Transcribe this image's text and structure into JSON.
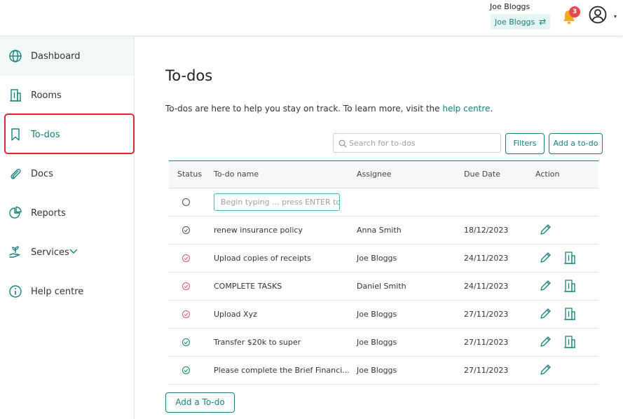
{
  "header": {
    "user_name": "Joe Bloggs",
    "account_label": "Joe Bloggs",
    "switch_symbol": "⇄",
    "notification_count": "3",
    "caret": "▾"
  },
  "sidebar": {
    "items": [
      {
        "label": "Dashboard",
        "icon": "globe-icon"
      },
      {
        "label": "Rooms",
        "icon": "building-icon"
      },
      {
        "label": "To-dos",
        "icon": "bookmark-icon"
      },
      {
        "label": "Docs",
        "icon": "paperclip-icon"
      },
      {
        "label": "Reports",
        "icon": "pie-chart-icon"
      },
      {
        "label": "Services",
        "icon": "plant-hand-icon"
      },
      {
        "label": "Help centre",
        "icon": "info-icon"
      }
    ]
  },
  "main": {
    "title": "To-dos",
    "intro_text": "To-dos are here to help you stay on track. To learn more, visit the ",
    "intro_link": "help centre",
    "intro_end": ".",
    "search_placeholder": "Search for to-dos",
    "filters_label": "Filters",
    "add_todo_label": "Add a to-do",
    "new_todo_placeholder": "Begin typing ... press ENTER to s",
    "add_bottom_label": "Add a To-do"
  },
  "table": {
    "columns": [
      "Status",
      "To-do name",
      "Assignee",
      "Due Date",
      "Action"
    ],
    "rows": [
      {
        "name": "renew insurance policy",
        "assignee": "Anna Smith",
        "due": "18/12/2023",
        "status": "done",
        "room": false
      },
      {
        "name": "Upload copies of receipts",
        "assignee": "Joe Bloggs",
        "due": "24/11/2023",
        "status": "overdue",
        "room": true
      },
      {
        "name": "COMPLETE TASKS",
        "assignee": "Daniel Smith",
        "due": "24/11/2023",
        "status": "overdue",
        "room": true
      },
      {
        "name": "Upload Xyz",
        "assignee": "Joe Bloggs",
        "due": "27/11/2023",
        "status": "overdue",
        "room": true
      },
      {
        "name": "Transfer $20k to super",
        "assignee": "Joe Bloggs",
        "due": "27/11/2023",
        "status": "done",
        "room": true
      },
      {
        "name": "Please complete the Brief Financi...",
        "assignee": "Joe Bloggs",
        "due": "27/11/2023",
        "status": "done",
        "room": false
      }
    ]
  },
  "colors": {
    "brand": "#16807a",
    "overdue": "#e05563",
    "done": "#16807a",
    "badge": "#e5484d",
    "bell": "#f5a623",
    "annotation": "#e0262e"
  }
}
